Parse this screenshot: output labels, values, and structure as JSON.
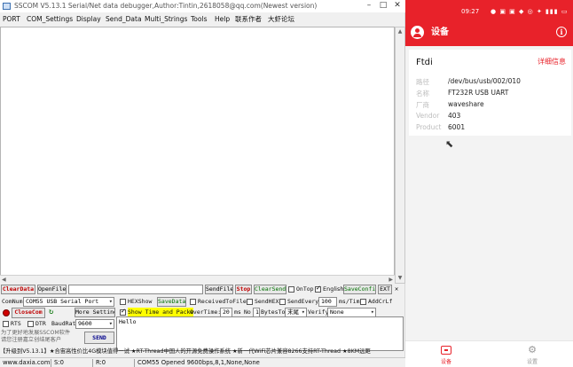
{
  "window": {
    "title": "SSCOM V5.13.1 Serial/Net data debugger,Author:Tintin,2618058@qq.com(Newest version)"
  },
  "menu": [
    "PORT",
    "COM_Settings",
    "Display",
    "Send_Data",
    "Multi_Strings",
    "Tools",
    "Help",
    "联系作者",
    "大虾论坛"
  ],
  "toolbar": {
    "clear_data": "ClearData",
    "open_file": "OpenFile",
    "file_path": "",
    "send_file": "SendFile",
    "stop": "Stop",
    "clear_send": "ClearSend",
    "on_top": "OnTop",
    "on_top_checked": false,
    "english": "English",
    "english_checked": true,
    "save_config": "SaveConfig",
    "ext": "EXT"
  },
  "port_settings": {
    "com_num_label": "ComNum",
    "com_num_value": "COM55 USB Serial Port",
    "close_com": "CloseCom",
    "more_settings": "More Settings",
    "rts": "RTS",
    "dtr": "DTR",
    "baud_rate_label": "BaudRat",
    "baud_rate_value": "9600"
  },
  "display_options": {
    "hex_show": "HEXShow",
    "save_data": "SaveData",
    "received_to_file": "ReceivedToFile",
    "send_hex": "SendHEX",
    "send_every": "SendEvery:",
    "send_every_value": "100",
    "ms_tim": "ms/Tim",
    "add_crlf": "AddCrLf",
    "show_time": "Show Time and Packe",
    "show_time_checked": true,
    "over_time_label": "OverTime:",
    "over_time_value": "20",
    "ms_label": "ms",
    "no_label": "No",
    "no_value": "1",
    "bytes_to_label": "BytesTo",
    "bytes_to_value": "末尾",
    "verify_label": "Verify",
    "verify_value": "None"
  },
  "send": {
    "text": "Hello",
    "send_button": "SEND"
  },
  "promo_left": "为了更好地发展SSCOM软件\n请您注册嘉立创结尾客户",
  "promo_bar": "【升级到V5.13.1】★合宙高性价比4G模块值得一试 ★RT-Thread中国人的开源免费操作系统 ★新一代WiFi芯片兼容8266支持RT-Thread ★8KM远距",
  "status": {
    "website": "www.daxia.com",
    "sent": "S:0",
    "received": "R:0",
    "port_status": "COM55 Opened  9600bps,8,1,None,None"
  },
  "phone": {
    "clock": "09:27",
    "status_icons": "● ▣ ▣ ◆ ◎ ✦ ▮▮▮ ▭",
    "header_title": "设备",
    "device_name": "Ftdi",
    "details_link": "详细信息",
    "rows": [
      {
        "label": "路径",
        "value": "/dev/bus/usb/002/010"
      },
      {
        "label": "名称",
        "value": "FT232R USB UART"
      },
      {
        "label": "厂商",
        "value": "waveshare"
      },
      {
        "label": "Vendor",
        "value": "403"
      },
      {
        "label": "Product",
        "value": "6001"
      }
    ],
    "nav": [
      {
        "label": "设备",
        "icon": "device-icon",
        "active": true
      },
      {
        "label": "设置",
        "icon": "settings-icon",
        "active": false
      }
    ]
  }
}
